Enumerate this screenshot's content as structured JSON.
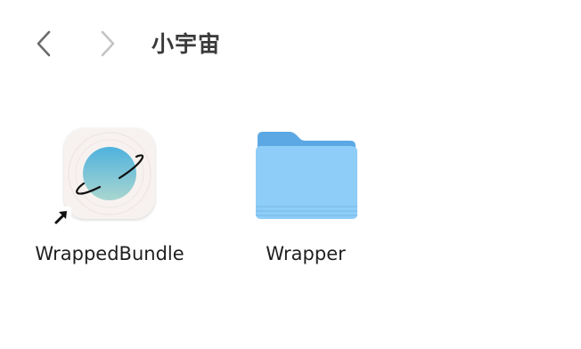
{
  "toolbar": {
    "back_icon": "chevron-left-icon",
    "forward_icon": "chevron-right-icon",
    "title": "小宇宙"
  },
  "items": [
    {
      "label": "WrappedBundle",
      "icon": "planet-app-icon",
      "alias": true
    },
    {
      "label": "Wrapper",
      "icon": "folder-icon",
      "alias": false
    }
  ],
  "colors": {
    "title_text": "#3a3a3a",
    "label_text": "#1f1f1f",
    "nav_back": "#6b6b6b",
    "nav_forward_disabled": "#c4c4c4",
    "folder_front": "#8ecdf7",
    "folder_back": "#5ba8e4",
    "planet_top": "#4fb2de",
    "planet_bottom": "#a9d6cf",
    "app_tile_bg": "#f7f2f0"
  }
}
